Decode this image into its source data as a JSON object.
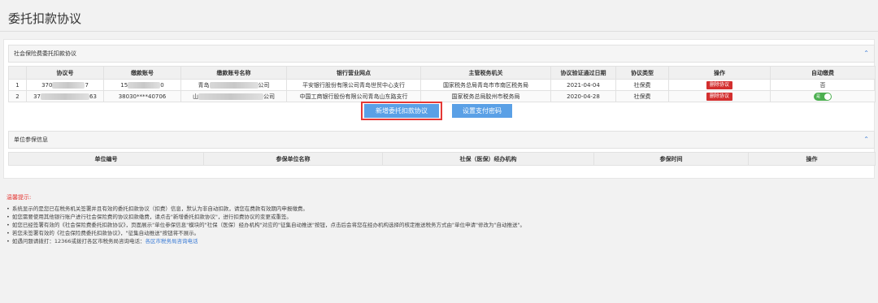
{
  "page": {
    "title": "委托扣款协议"
  },
  "social_panel": {
    "title": "社会保险费委托扣款协议",
    "columns": [
      "协议号",
      "缴款账号",
      "缴款账号名称",
      "银行营业网点",
      "主管税务机关",
      "协议验证通过日期",
      "协议类型",
      "操作",
      "自动缴费"
    ],
    "rows": [
      {
        "idx": "1",
        "agreement_no_prefix": "370",
        "agreement_no_suffix": "7",
        "account_prefix": "15",
        "account_suffix": "0",
        "account_name_prefix": "青岛",
        "account_name_suffix": "公司",
        "bank": "平安银行股份有限公司青岛世贸中心支行",
        "tax_office": "国家税务总局青岛市市南区税务局",
        "date": "2021-04-04",
        "type": "社保费",
        "action": "删除协议",
        "auto_pay": "否"
      },
      {
        "idx": "2",
        "agreement_no_prefix": "37",
        "agreement_no_suffix": "63",
        "account": "38030****40706",
        "account_name_prefix": "山",
        "account_name_suffix": "公司",
        "bank": "中国工商银行股份有限公司青岛山东路支行",
        "tax_office": "国家税务总局胶州市税务局",
        "date": "2020-04-28",
        "type": "社保费",
        "action": "删除协议",
        "auto_pay_toggle": "是"
      }
    ],
    "buttons": {
      "new_agreement": "新增委托扣款协议",
      "set_password": "设置支付密码"
    }
  },
  "unit_panel": {
    "title": "单位参保信息",
    "columns": [
      "单位编号",
      "参保单位名称",
      "社保（医保）经办机构",
      "参保时间",
      "操作"
    ]
  },
  "tips": {
    "title": "温馨提示:",
    "items": [
      "系统显示的是您已在税务机关签署并且有效的委托扣款协议（扣费）信息，默认为非自动扣款，请您在费款有效期内申报缴费。",
      "如您需要使用其他银行账户进行社会保险费的协议扣款缴费，请点击\"新增委托扣款协议\"，进行扣费协议的变更或重签。",
      "如您已经签署有效的《社会保险费委托扣款协议》，页面展示\"单位参保信息\"模块的\"社保（医保）经办机构\"对应的\"征集自动推送\"按钮，点击后会将您在经办机构选择的核定推送税务方式由\"单位申请\"修改为\"自动推送\"。",
      "若您未签署有效的《社会保险费委托扣款协议》，\"征集自动推送\"按钮将不展示。"
    ],
    "contact_text": "如遇问题请拨打：12366或拨打各区市税务局咨询电话：",
    "contact_link": "各区市税务局咨询电话"
  },
  "colors": {
    "accent": "#5aa0e6",
    "danger": "#d32f2f",
    "highlight": "#e53935",
    "toggle_on": "#4caf50"
  }
}
